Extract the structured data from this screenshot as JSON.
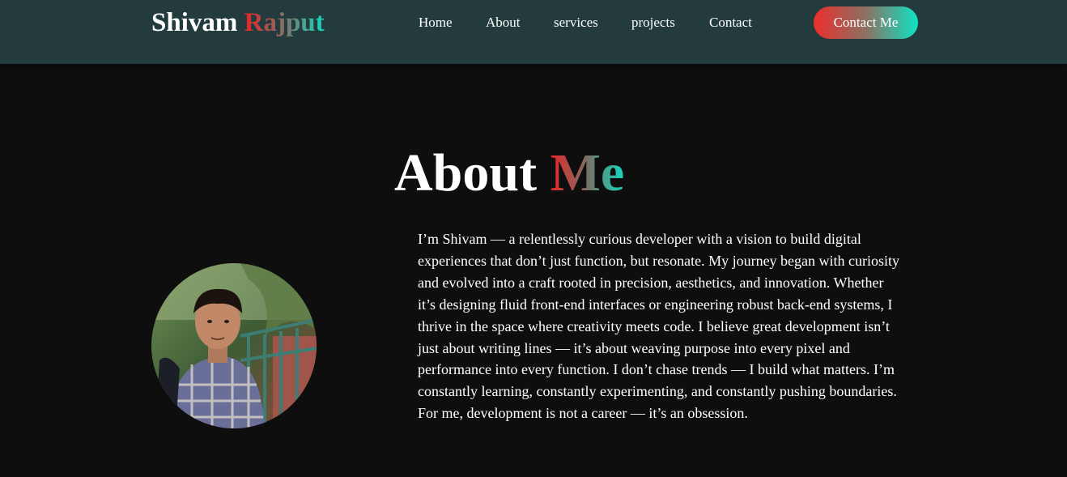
{
  "header": {
    "brand_first": "Shivam",
    "brand_second": "Rajput",
    "nav": {
      "home": "Home",
      "about": "About",
      "services": "services",
      "projects": "projects",
      "contact": "Contact"
    },
    "cta_label": "Contact Me"
  },
  "about": {
    "title_first": "About",
    "title_second": "Me",
    "bio": "I’m Shivam — a relentlessly curious developer with a vision to build digital experiences that don’t just function, but resonate. My journey began with curiosity and evolved into a craft rooted in precision, aesthetics, and innovation. Whether it’s designing fluid front-end interfaces or engineering robust back-end systems, I thrive in the space where creativity meets code. I believe great development isn’t just about writing lines — it’s about weaving purpose into every pixel and performance into every function. I don’t chase trends — I build what matters. I’m constantly learning, constantly experimenting, and constantly pushing boundaries. For me, development is not a career — it’s an obsession."
  },
  "colors": {
    "navbar_bg": "#233b3d",
    "page_bg": "#0e0e0e",
    "gradient_start": "#e6262a",
    "gradient_end": "#12d8c0"
  }
}
